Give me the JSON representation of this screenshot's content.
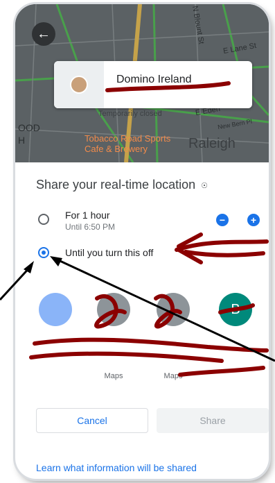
{
  "map": {
    "labels": {
      "street_1": "N Blount St",
      "street_2": "E Lane St",
      "street_3": "E Eden",
      "street_4": "New Bern Pl",
      "place_partial_1": "OOD",
      "place_partial_2": "H",
      "status": "Temporarily closed",
      "poi": "Tobacco Road Sports Cafe & Brewery",
      "city": "Raleigh"
    },
    "back_icon": "arrow-left-icon"
  },
  "card": {
    "name": "Domino Ireland"
  },
  "share": {
    "title": "Share your real-time location",
    "help_icon": "help-circle-icon",
    "option1": {
      "label": "For 1 hour",
      "sub": "Until 6:50 PM"
    },
    "option2": {
      "label": "Until you turn this off",
      "selected": true
    }
  },
  "contacts": [
    {
      "caption": "",
      "icon": "person-icon",
      "color": "#4285f4"
    },
    {
      "caption": "Maps",
      "icon": "maps-icon",
      "color": "#7f8c8d"
    },
    {
      "caption": "Maps",
      "icon": "maps-icon",
      "color": "#7f8c8d"
    },
    {
      "caption": "",
      "icon": "contact-letter-icon",
      "letter": "B",
      "color": "#00897b"
    }
  ],
  "buttons": {
    "cancel": "Cancel",
    "share": "Share"
  },
  "footer": {
    "learn_link": "Learn what information will be shared"
  },
  "colors": {
    "accent": "#1a73e8",
    "annotation_red": "#8b0000",
    "annotation_black": "#000000"
  }
}
